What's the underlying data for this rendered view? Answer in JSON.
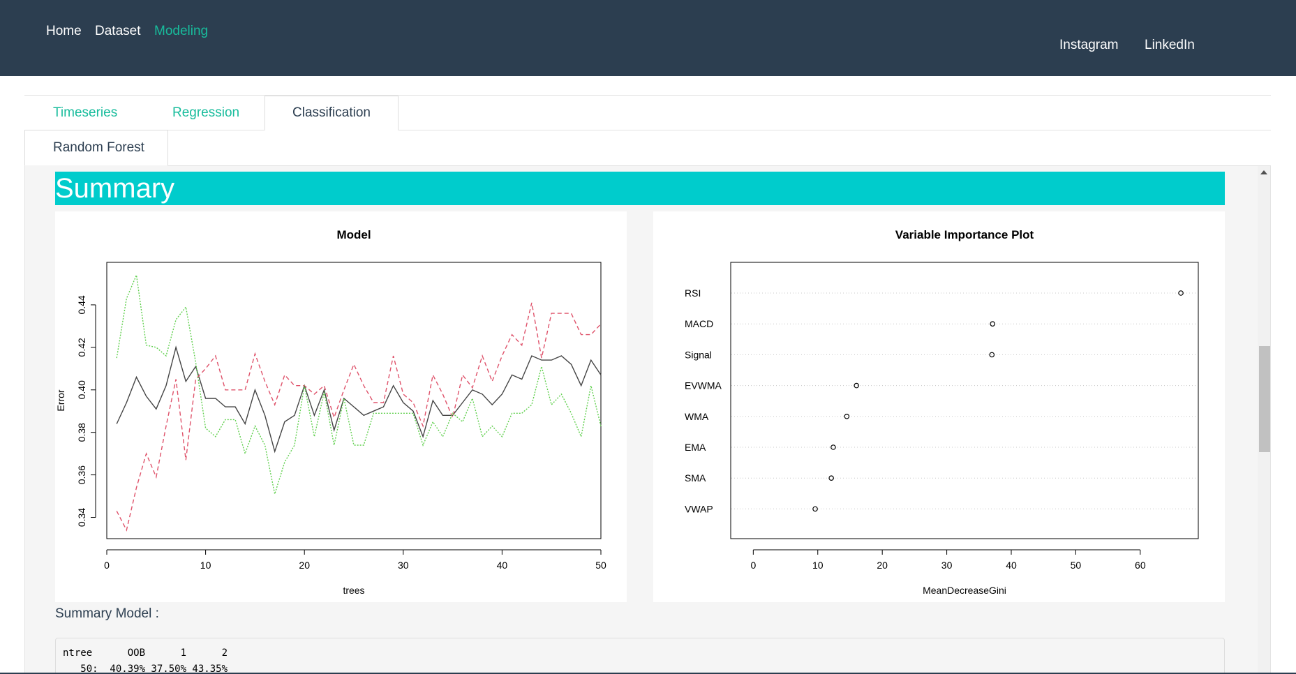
{
  "navbar": {
    "left_links": [
      {
        "label": "Home",
        "active": false
      },
      {
        "label": "Dataset",
        "active": false
      },
      {
        "label": "Modeling",
        "active": true
      }
    ],
    "right_links": [
      {
        "label": "Instagram"
      },
      {
        "label": "LinkedIn"
      }
    ]
  },
  "tabs": {
    "main": [
      {
        "label": "Timeseries",
        "active": false
      },
      {
        "label": "Regression",
        "active": false
      },
      {
        "label": "Classification",
        "active": true
      }
    ],
    "sub": [
      {
        "label": "Random Forest",
        "active": true
      }
    ]
  },
  "summary": {
    "banner": "Summary",
    "model_label": "Summary Model :",
    "output_lines": [
      "ntree      OOB      1      2",
      "   50:  40.39% 37.50% 43.35%"
    ]
  },
  "colors": {
    "navbar": "#2c3e50",
    "accent": "#18bc9c",
    "banner": "#00cccc"
  },
  "chart_data": [
    {
      "type": "line",
      "title": "Model",
      "xlabel": "trees",
      "ylabel": "Error",
      "xlim": [
        0,
        50
      ],
      "ylim": [
        0.33,
        0.46
      ],
      "xticks": [
        0,
        10,
        20,
        30,
        40,
        50
      ],
      "yticks": [
        0.34,
        0.36,
        0.38,
        0.4,
        0.42,
        0.44
      ],
      "ytick_labels": [
        "0.34",
        "0.36",
        "0.38",
        "0.40",
        "0.42",
        "0.44"
      ],
      "x": [
        1,
        2,
        3,
        4,
        5,
        6,
        7,
        8,
        9,
        10,
        11,
        12,
        13,
        14,
        15,
        16,
        17,
        18,
        19,
        20,
        21,
        22,
        23,
        24,
        25,
        26,
        27,
        28,
        29,
        30,
        31,
        32,
        33,
        34,
        35,
        36,
        37,
        38,
        39,
        40,
        41,
        42,
        43,
        44,
        45,
        46,
        47,
        48,
        49,
        50
      ],
      "series": [
        {
          "color": "#444444",
          "dash": "solid",
          "values": [
            0.384,
            0.394,
            0.406,
            0.397,
            0.391,
            0.402,
            0.42,
            0.404,
            0.411,
            0.396,
            0.396,
            0.392,
            0.392,
            0.384,
            0.4,
            0.388,
            0.371,
            0.385,
            0.388,
            0.402,
            0.388,
            0.4,
            0.381,
            0.396,
            0.392,
            0.388,
            0.39,
            0.392,
            0.402,
            0.394,
            0.39,
            0.378,
            0.395,
            0.388,
            0.388,
            0.394,
            0.4,
            0.398,
            0.393,
            0.398,
            0.407,
            0.405,
            0.416,
            0.414,
            0.414,
            0.416,
            0.412,
            0.402,
            0.414,
            0.407
          ]
        },
        {
          "color": "#df536b",
          "dash": "dashed",
          "values": [
            0.343,
            0.334,
            0.354,
            0.37,
            0.359,
            0.383,
            0.405,
            0.367,
            0.405,
            0.41,
            0.416,
            0.4,
            0.4,
            0.4,
            0.417,
            0.404,
            0.393,
            0.407,
            0.402,
            0.402,
            0.398,
            0.402,
            0.387,
            0.4,
            0.412,
            0.402,
            0.394,
            0.394,
            0.416,
            0.398,
            0.394,
            0.383,
            0.407,
            0.398,
            0.387,
            0.407,
            0.401,
            0.416,
            0.404,
            0.416,
            0.426,
            0.421,
            0.441,
            0.415,
            0.436,
            0.436,
            0.436,
            0.426,
            0.426,
            0.431
          ]
        },
        {
          "color": "#61d04f",
          "dash": "dotted",
          "values": [
            0.415,
            0.443,
            0.454,
            0.421,
            0.42,
            0.416,
            0.433,
            0.439,
            0.413,
            0.382,
            0.378,
            0.386,
            0.386,
            0.37,
            0.383,
            0.374,
            0.351,
            0.366,
            0.374,
            0.402,
            0.378,
            0.399,
            0.374,
            0.396,
            0.374,
            0.374,
            0.389,
            0.389,
            0.389,
            0.389,
            0.389,
            0.374,
            0.385,
            0.378,
            0.389,
            0.385,
            0.396,
            0.378,
            0.383,
            0.378,
            0.389,
            0.389,
            0.393,
            0.411,
            0.393,
            0.398,
            0.389,
            0.378,
            0.402,
            0.383
          ]
        }
      ]
    },
    {
      "type": "scatter",
      "title": "Variable Importance Plot",
      "xlabel": "MeanDecreaseGini",
      "xlim": [
        -3.5,
        69
      ],
      "xticks": [
        0,
        10,
        20,
        30,
        40,
        50,
        60
      ],
      "categories": [
        "RSI",
        "MACD",
        "Signal",
        "EVWMA",
        "WMA",
        "EMA",
        "SMA",
        "VWAP"
      ],
      "values": [
        66.3,
        37.1,
        37.0,
        16.0,
        14.5,
        12.4,
        12.1,
        9.6
      ]
    }
  ]
}
